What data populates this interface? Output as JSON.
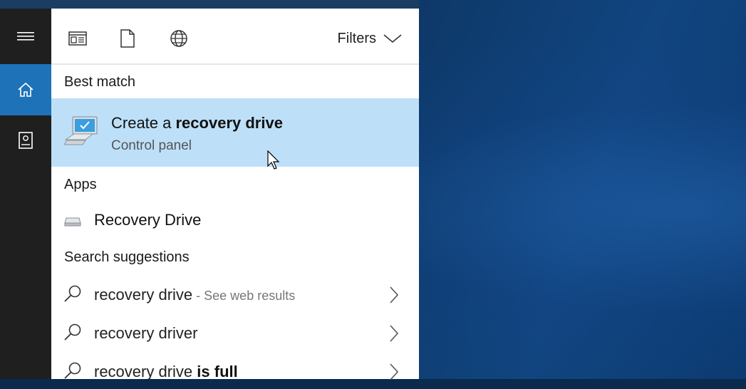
{
  "toolbar": {
    "filters_label": "Filters",
    "icons": [
      "apps-icon",
      "document-icon",
      "web-icon",
      "chevron-down-icon"
    ]
  },
  "sidebar": {
    "items": [
      {
        "icon": "hamburger-menu-icon",
        "selected": false
      },
      {
        "icon": "home-icon",
        "selected": true
      },
      {
        "icon": "notebook-icon",
        "selected": false
      }
    ]
  },
  "sections": {
    "best_match": "Best match",
    "apps": "Apps",
    "suggestions": "Search suggestions"
  },
  "best_match": {
    "title_prefix": "Create a ",
    "title_bold": "recovery drive",
    "subtitle": "Control panel"
  },
  "apps": [
    {
      "name": "Recovery Drive"
    }
  ],
  "suggestions": [
    {
      "text": "recovery drive",
      "bold": "",
      "hint": " - See web results"
    },
    {
      "text": "recovery driver",
      "bold": "",
      "hint": ""
    },
    {
      "text": "recovery drive ",
      "bold": "is full",
      "hint": ""
    }
  ],
  "colors": {
    "accent": "#1e72b8",
    "selection": "#bde0f8",
    "rail": "#1f1f1f"
  }
}
